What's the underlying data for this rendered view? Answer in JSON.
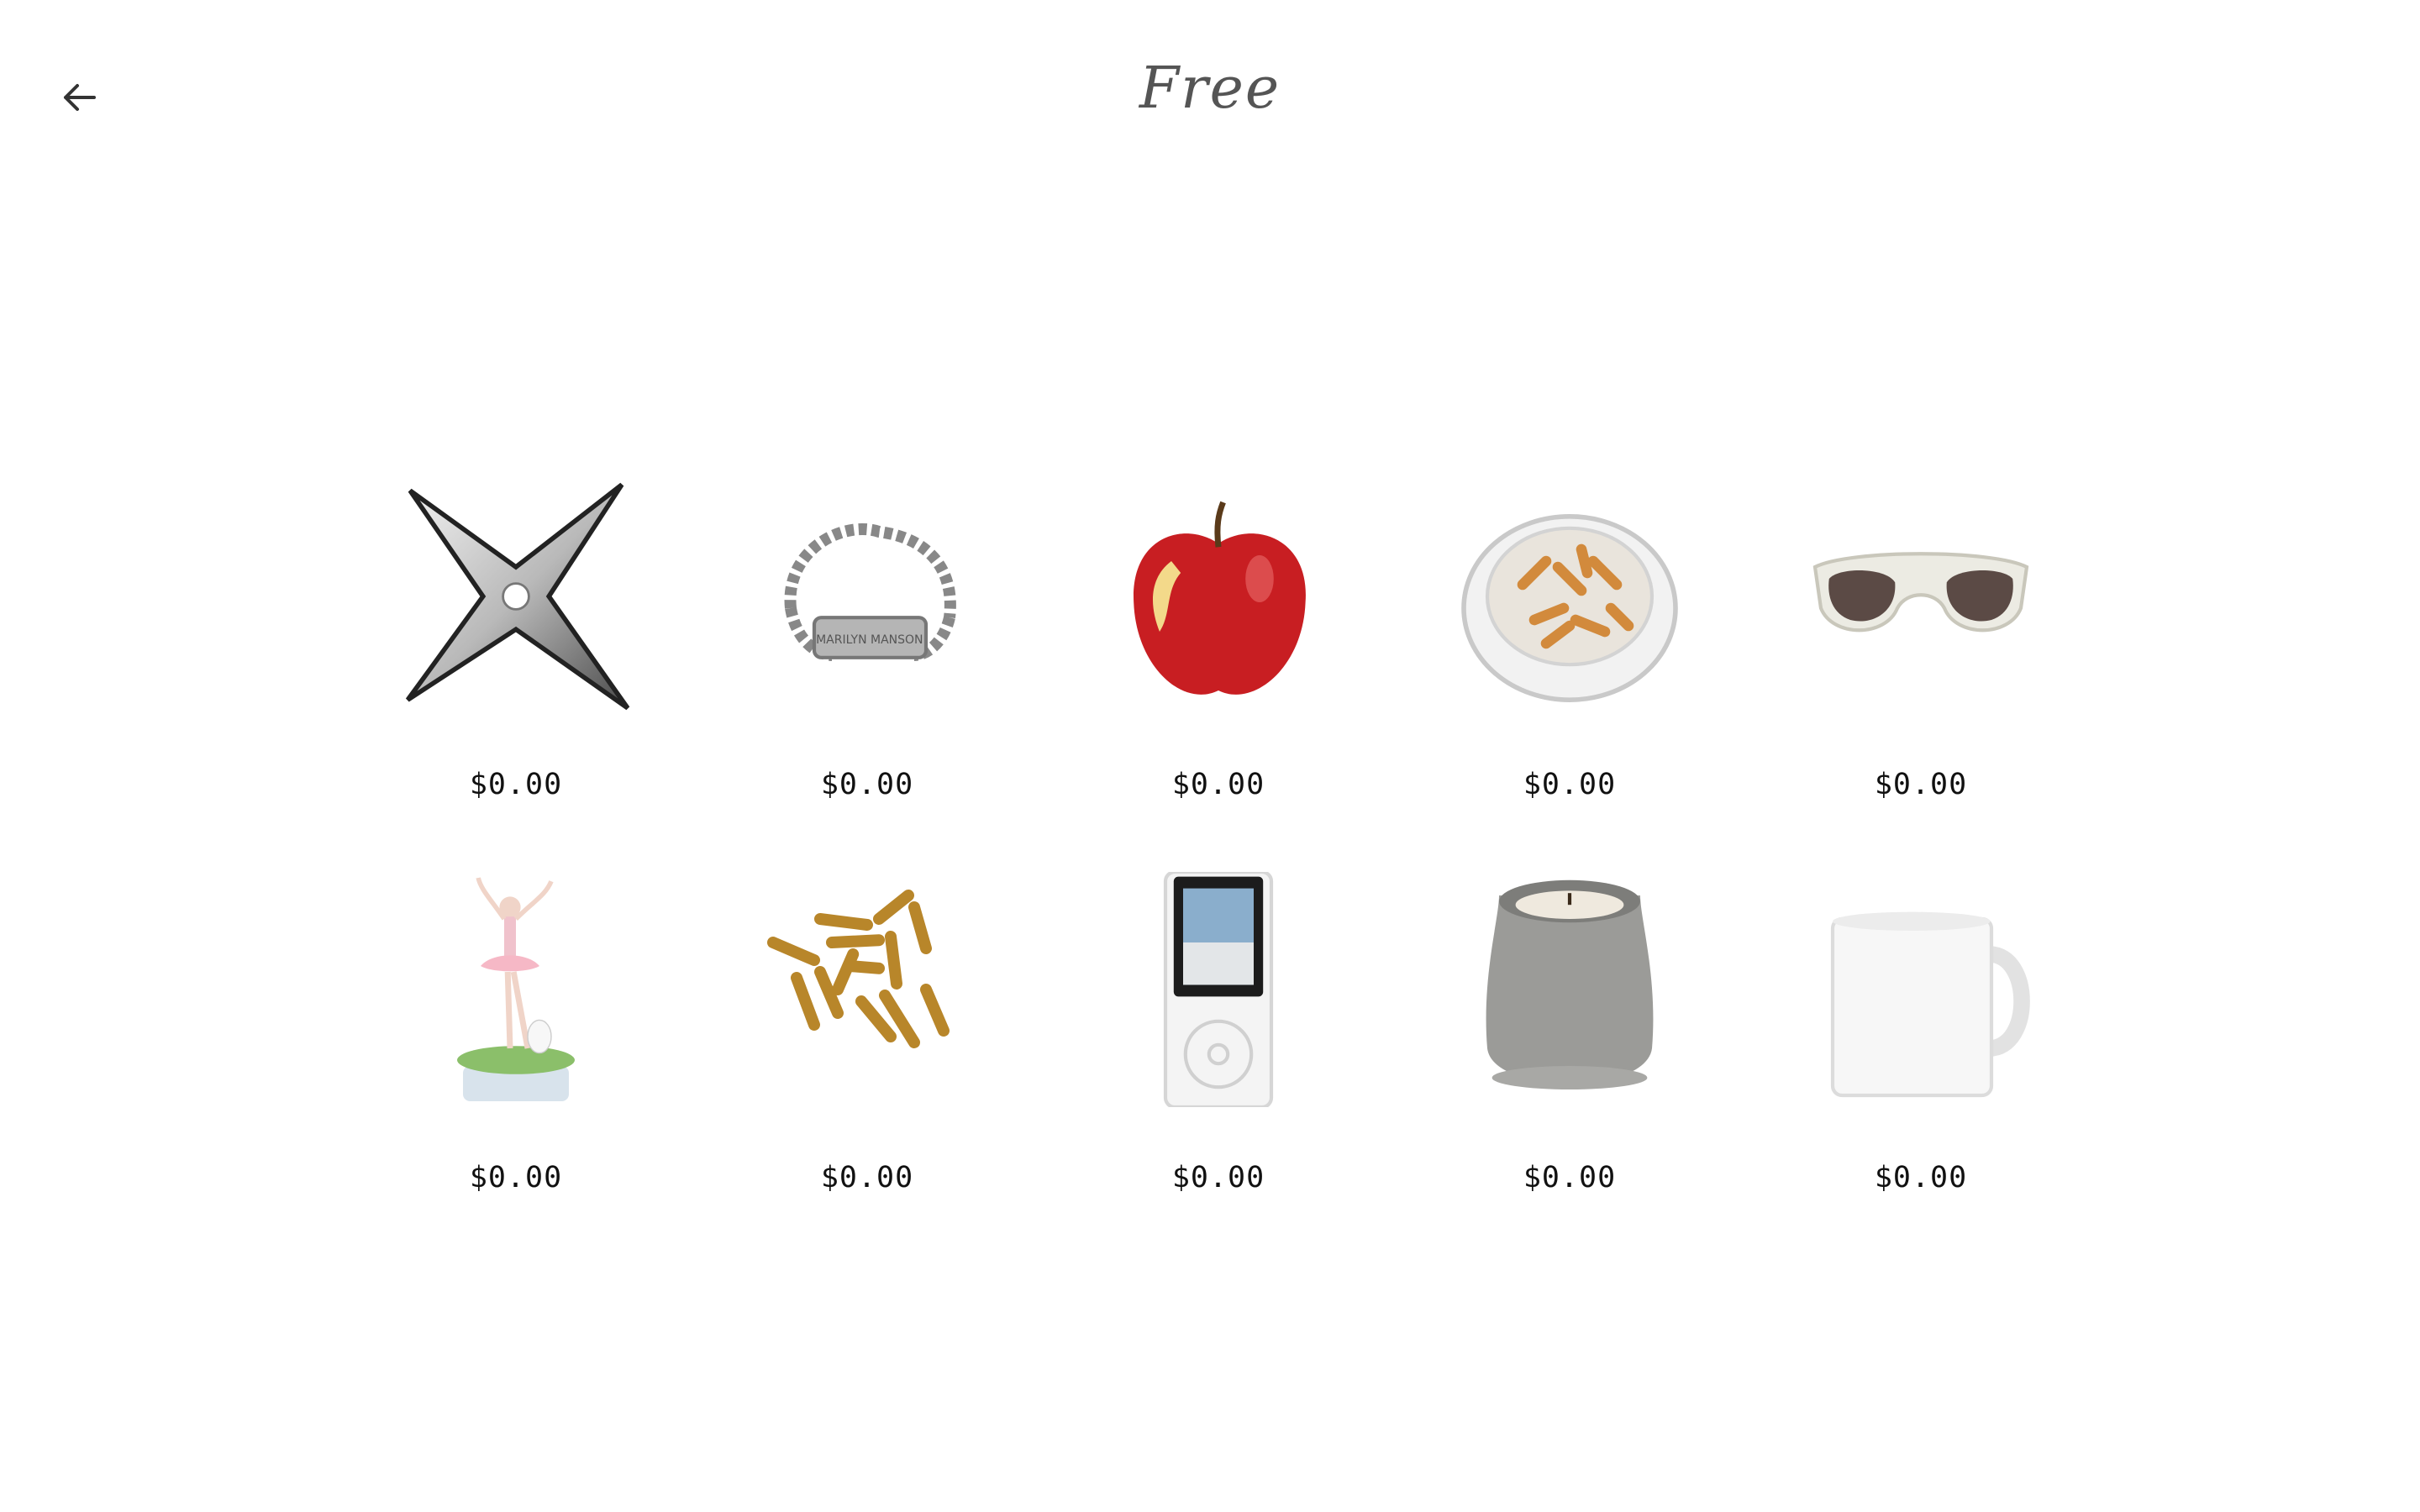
{
  "header": {
    "title": "Free",
    "back_icon": "arrow-left-icon"
  },
  "products": [
    {
      "name": "shuriken",
      "icon": "shuriken-icon",
      "price": "$0.00"
    },
    {
      "name": "id-bracelet",
      "icon": "bracelet-icon",
      "price": "$0.00",
      "engraving": "MARILYN MANSON"
    },
    {
      "name": "apple",
      "icon": "apple-icon",
      "price": "$0.00"
    },
    {
      "name": "ashtray",
      "icon": "ashtray-icon",
      "price": "$0.00"
    },
    {
      "name": "sunglasses",
      "icon": "sunglasses-icon",
      "price": "$0.00"
    },
    {
      "name": "ballerina-music-box",
      "icon": "ballerina-icon",
      "price": "$0.00"
    },
    {
      "name": "bullets",
      "icon": "bullets-icon",
      "price": "$0.00"
    },
    {
      "name": "mp3-player",
      "icon": "mp3-player-icon",
      "price": "$0.00"
    },
    {
      "name": "concrete-candle",
      "icon": "candle-icon",
      "price": "$0.00"
    },
    {
      "name": "white-mug",
      "icon": "mug-icon",
      "price": "$0.00"
    }
  ]
}
